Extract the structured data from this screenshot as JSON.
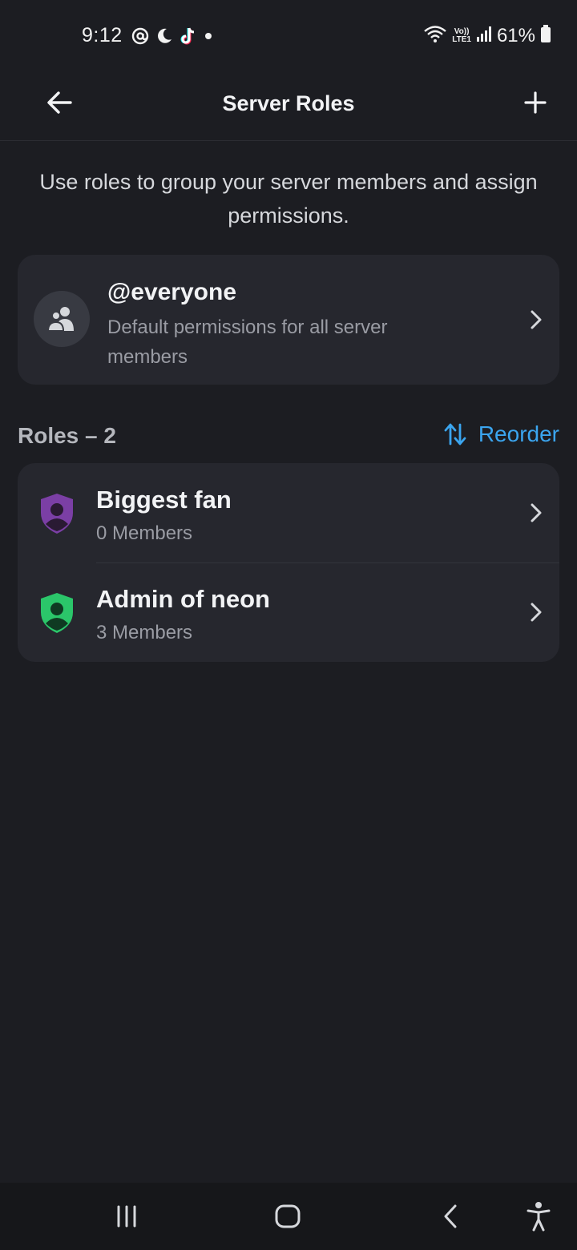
{
  "status_bar": {
    "time": "9:12",
    "battery_percent": "61%",
    "network_label_top": "Vo))",
    "network_label_bottom": "LTE1",
    "left_icons": [
      "at-sign-icon",
      "moon-icon",
      "tiktok-icon",
      "dot-icon"
    ],
    "right_icons": [
      "wifi-icon",
      "signal-icon",
      "battery-icon"
    ]
  },
  "header": {
    "title": "Server Roles",
    "back_icon": "arrow-left-icon",
    "add_icon": "plus-icon"
  },
  "description": "Use roles to group your server members and assign permissions.",
  "everyone": {
    "title": "@everyone",
    "subtitle": "Default permissions for all server members",
    "icon": "members-icon"
  },
  "roles_section": {
    "heading": "Roles – 2",
    "reorder_label": "Reorder",
    "reorder_icon": "sort-arrows-icon"
  },
  "roles": [
    {
      "name": "Biggest fan",
      "members": "0 Members",
      "color": "#7b3fa5"
    },
    {
      "name": "Admin of neon",
      "members": "3 Members",
      "color": "#2bc66a"
    }
  ],
  "nav_bar": {
    "icons": [
      "recent-apps-icon",
      "home-icon",
      "back-icon",
      "accessibility-icon"
    ]
  },
  "colors": {
    "background": "#1c1d22",
    "card": "#26272e",
    "accent": "#3ba5ef",
    "muted_text": "#9a9ca4"
  }
}
